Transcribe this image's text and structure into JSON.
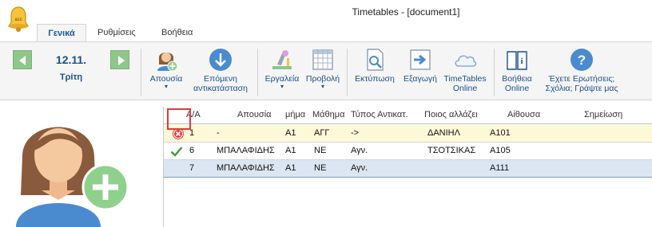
{
  "window": {
    "title": "Timetables - [document1]"
  },
  "tabs": [
    {
      "label": "Γενικά",
      "active": true
    },
    {
      "label": "Ρυθμίσεις",
      "active": false
    },
    {
      "label": "Βοήθεια",
      "active": false
    }
  ],
  "date_nav": {
    "date": "12.11.",
    "day": "Τρίτη"
  },
  "ribbon": {
    "absence": "Απουσία",
    "next_sub_line1": "Επόμενη",
    "next_sub_line2": "αντικατάσταση",
    "tools": "Εργαλεία",
    "view": "Προβολή",
    "print": "Εκτύπωση",
    "export": "Εξαγωγή",
    "online_line1": "TimeTables",
    "online_line2": "Online",
    "help_line1": "Βοήθεια",
    "help_line2": "Online",
    "questions_line1": "Έχετε Ερωτήσεις;",
    "questions_line2": "Σχόλια; Γράψτε μας"
  },
  "grid": {
    "columns": [
      "Α/Α",
      "Απουσία",
      "μήμα",
      "Μάθημα",
      "Τύπος Αντικατ.",
      "Ποιος αλλάζει",
      "Αίθουσα",
      "Σημείωση"
    ],
    "rows": [
      {
        "status": "error",
        "aa": "1",
        "absence": "-",
        "class": "Α1",
        "subject": "ΑΓΓ",
        "type": "->",
        "who": "ΔΑΝΙΗΛ",
        "room": "Α101",
        "note": ""
      },
      {
        "status": "ok",
        "aa": "6",
        "absence": "ΜΠΑΛΑΦΙΔΗΣ",
        "class": "Α1",
        "subject": "ΝΕ",
        "type": "Αγν.",
        "who": "ΤΣΟΤΣΙΚΑΣ",
        "room": "Α105",
        "note": ""
      },
      {
        "status": "none",
        "aa": "7",
        "absence": "ΜΠΑΛΑΦΙΔΗΣ",
        "class": "Α1",
        "subject": "ΝΕ",
        "type": "Αγν.",
        "who": "",
        "room": "Α111",
        "note": ""
      }
    ]
  },
  "colors": {
    "accent": "#1b4f8c",
    "nav_green": "#8fc68a",
    "highlight_row": "#fdf9d8",
    "selected_row": "#dbe6f2",
    "error_red": "#e03a3a"
  }
}
